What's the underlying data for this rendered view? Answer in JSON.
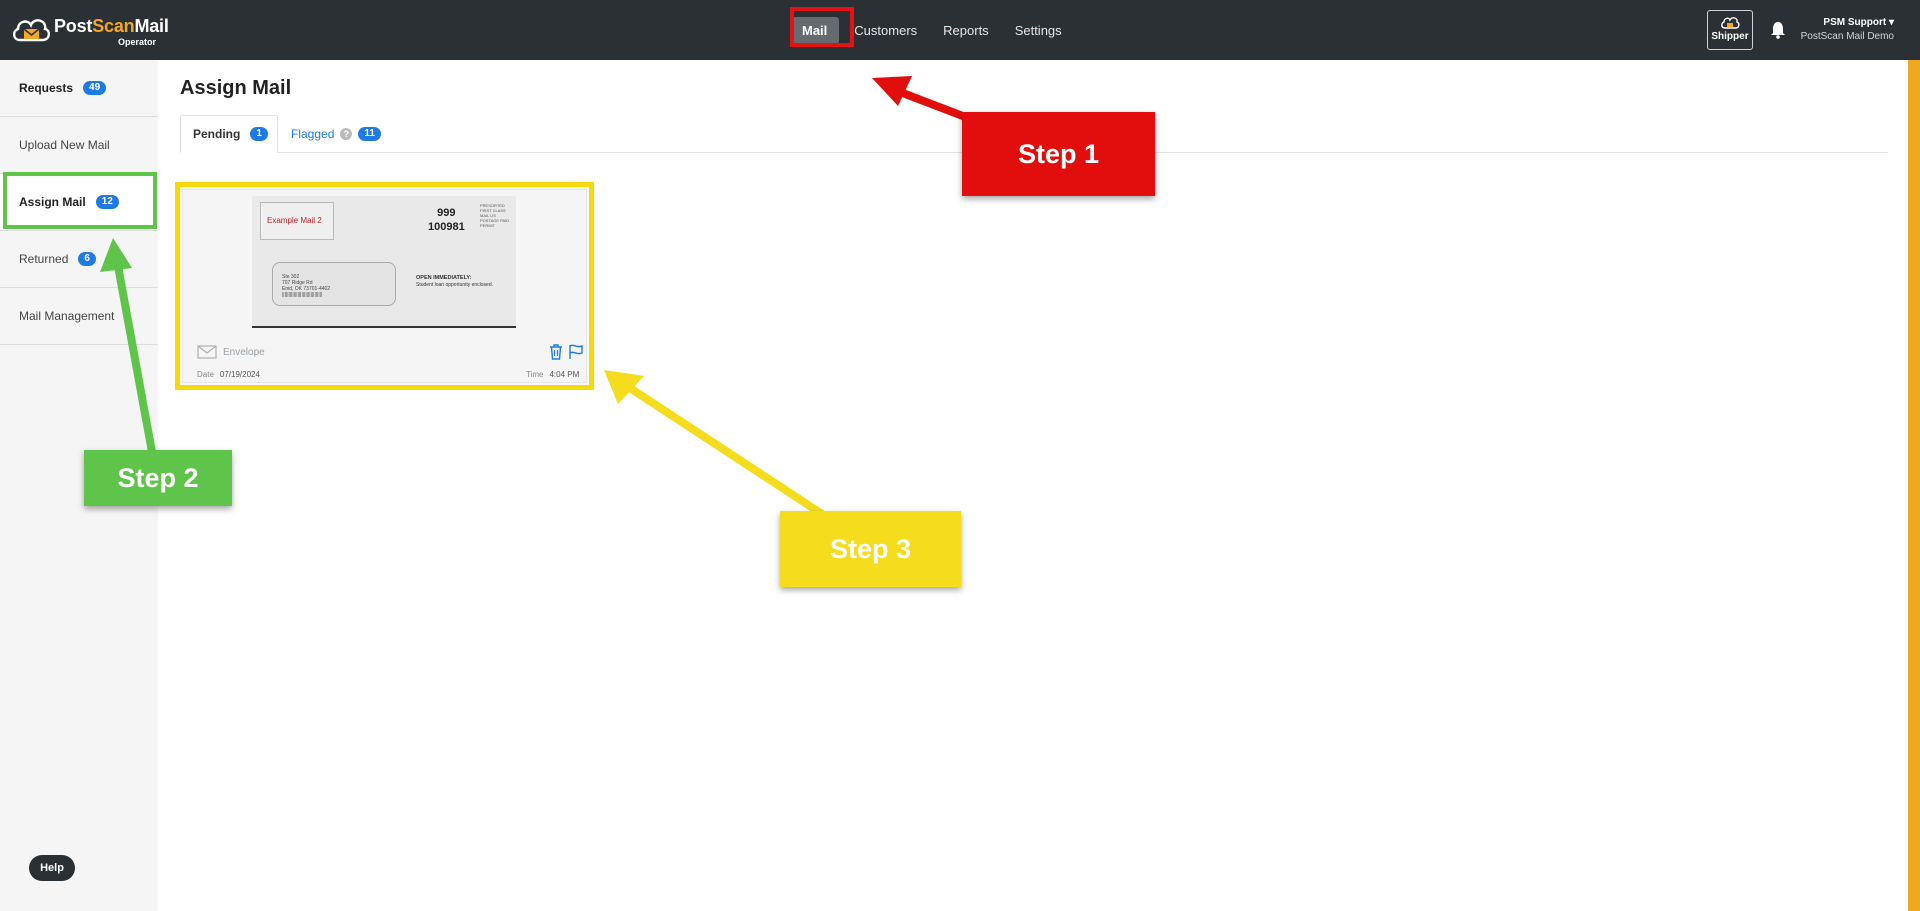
{
  "app": {
    "logo_post": "Post",
    "logo_scan": "Scan",
    "logo_mail": "Mail",
    "logo_sub": "Operator"
  },
  "nav": {
    "items": [
      "Mail",
      "Customers",
      "Reports",
      "Settings"
    ],
    "active": "Mail"
  },
  "header_right": {
    "shipper_label": "Shipper",
    "user_name": "PSM Support",
    "user_org": "PostScan Mail Demo"
  },
  "sidebar": {
    "items": [
      {
        "label": "Requests",
        "badge": "49"
      },
      {
        "label": "Upload New Mail",
        "badge": ""
      },
      {
        "label": "Assign Mail",
        "badge": "12"
      },
      {
        "label": "Returned",
        "badge": "6"
      },
      {
        "label": "Mail Management",
        "badge": ""
      }
    ],
    "active": "Assign Mail",
    "help_label": "Help"
  },
  "main": {
    "title": "Assign Mail",
    "tabs": [
      {
        "label": "Pending",
        "badge": "1"
      },
      {
        "label": "Flagged",
        "badge": "11"
      }
    ],
    "mail_card": {
      "image_label": "Example Mail 2",
      "number_line1": "999",
      "number_line2": "100981",
      "tiny_text": "PRESORTED FIRST CLASS MAIL US POSTAGE PAID PERMIT",
      "address_lines": [
        "Ste 302",
        "707 Ridge Rd",
        "Enid, OK 73701-4402",
        "|||||||||||||||||||||||||||||||"
      ],
      "open_title": "OPEN IMMEDIATELY:",
      "open_text": "Student loan opportunity enclosed.",
      "type": "Envelope",
      "date_label": "Date",
      "date_value": "07/19/2024",
      "time_label": "Time",
      "time_value": "4:04 PM"
    }
  },
  "callouts": {
    "step1": "Step 1",
    "step2": "Step 2",
    "step3": "Step 3"
  },
  "colors": {
    "topbar": "#2b3034",
    "accent_blue": "#1e7be6",
    "brand_orange": "#f5a623",
    "step1_red": "#e20e0e",
    "step2_green": "#5fc54a",
    "step3_yellow": "#f5dc1c"
  }
}
